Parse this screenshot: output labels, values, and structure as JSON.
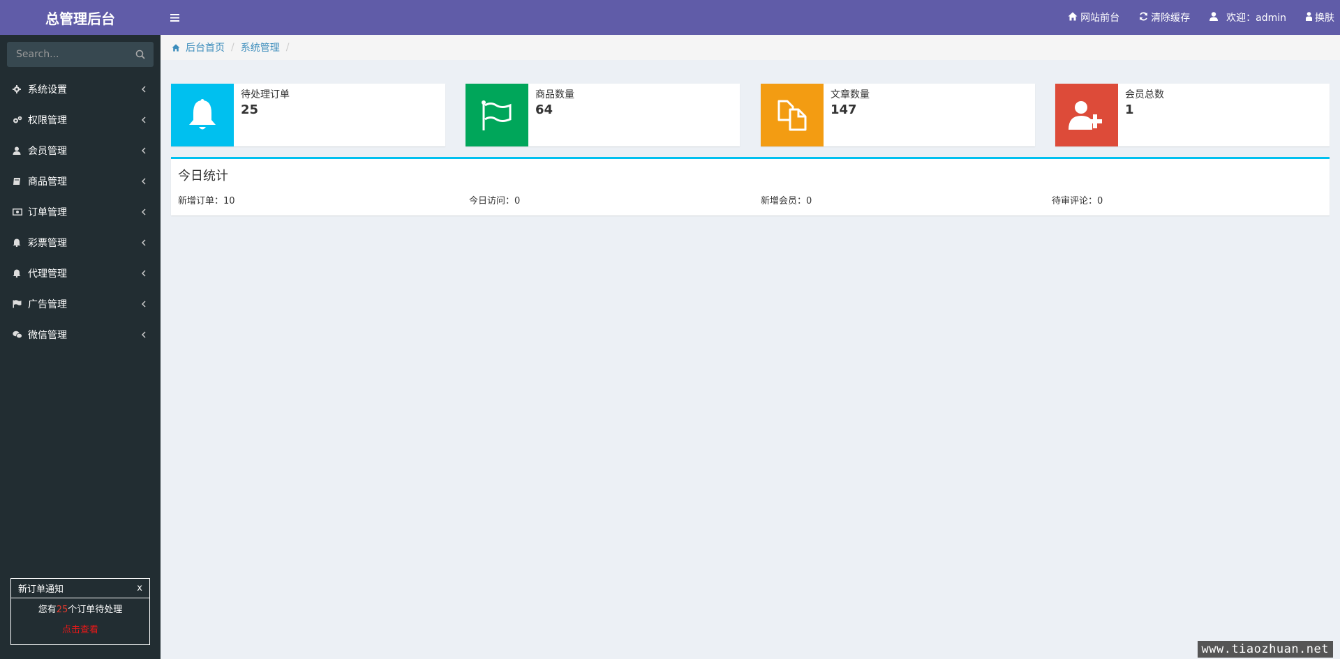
{
  "app": {
    "title": "总管理后台"
  },
  "search": {
    "placeholder": "Search..."
  },
  "sidebar": {
    "items": [
      {
        "label": "系统设置",
        "icon": "gear-icon"
      },
      {
        "label": "权限管理",
        "icon": "gears-icon"
      },
      {
        "label": "会员管理",
        "icon": "user-icon"
      },
      {
        "label": "商品管理",
        "icon": "book-icon"
      },
      {
        "label": "订单管理",
        "icon": "money-icon"
      },
      {
        "label": "彩票管理",
        "icon": "bell-icon"
      },
      {
        "label": "代理管理",
        "icon": "bell-icon"
      },
      {
        "label": "广告管理",
        "icon": "flag-icon"
      },
      {
        "label": "微信管理",
        "icon": "wechat-icon"
      }
    ]
  },
  "notice": {
    "title": "新订单通知",
    "close": "x",
    "prefix": "您有",
    "count": "25",
    "suffix": "个订单待处理",
    "link": "点击查看"
  },
  "topbar": {
    "site_front": "网站前台",
    "clear_cache": "清除缓存",
    "welcome": "欢迎：admin",
    "skin": "换肤"
  },
  "breadcrumb": {
    "home": "后台首页",
    "current": "系统管理",
    "sep": "/"
  },
  "info_boxes": [
    {
      "label": "待处理订单",
      "value": "25",
      "color": "#00c0ef",
      "icon": "bell-icon"
    },
    {
      "label": "商品数量",
      "value": "64",
      "color": "#00a65a",
      "icon": "flag-icon"
    },
    {
      "label": "文章数量",
      "value": "147",
      "color": "#f39c12",
      "icon": "files-icon"
    },
    {
      "label": "会员总数",
      "value": "1",
      "color": "#dd4b39",
      "icon": "user-plus-icon"
    }
  ],
  "today": {
    "title": "今日统计",
    "stats": [
      "新增订单：10",
      "今日访问：0",
      "新增会员：0",
      "待审评论：0"
    ]
  },
  "watermark": "www.tiaozhuan.net"
}
